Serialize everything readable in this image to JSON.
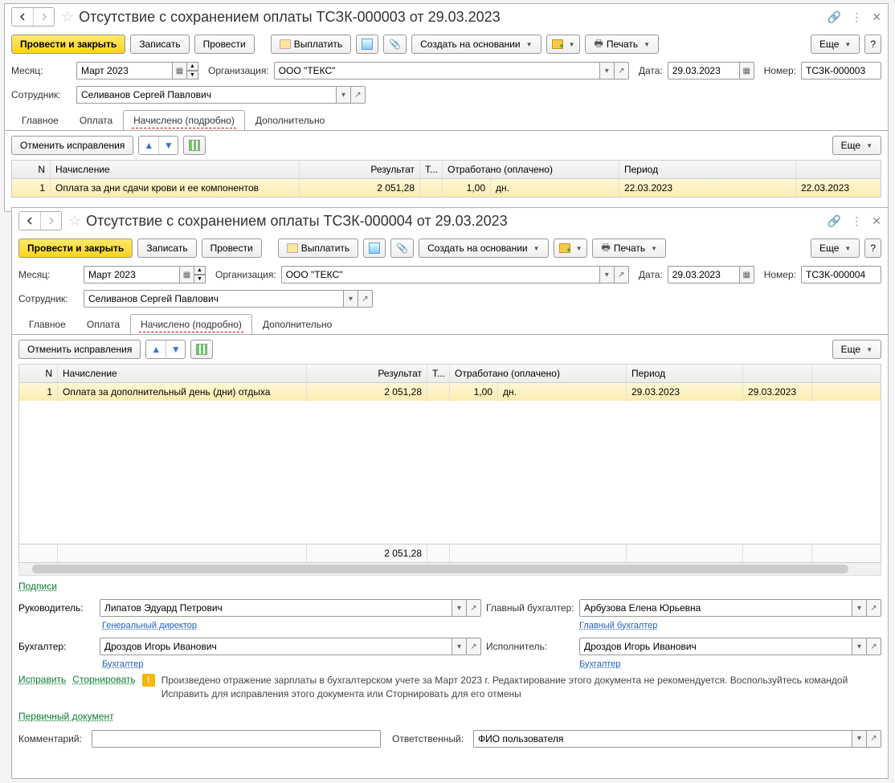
{
  "win1": {
    "title": "Отсутствие с сохранением оплаты ТСЗК-000003 от 29.03.2023",
    "toolbar": {
      "post_close": "Провести и закрыть",
      "write": "Записать",
      "post": "Провести",
      "pay": "Выплатить",
      "create_on": "Создать на основании",
      "print": "Печать",
      "more": "Еще"
    },
    "fields": {
      "month_lbl": "Месяц:",
      "month": "Март 2023",
      "org_lbl": "Организация:",
      "org": "ООО \"ТЕКС\"",
      "date_lbl": "Дата:",
      "date": "29.03.2023",
      "num_lbl": "Номер:",
      "num": "ТСЗК-000003",
      "emp_lbl": "Сотрудник:",
      "emp": "Селиванов Сергей Павлович"
    },
    "tabs": {
      "main": "Главное",
      "pay": "Оплата",
      "calc": "Начислено (подробно)",
      "extra": "Дополнительно"
    },
    "tabbar": {
      "cancel": "Отменить исправления",
      "more": "Еще"
    },
    "table": {
      "headers": {
        "n": "N",
        "nach": "Начисление",
        "res": "Результат",
        "t": "Т...",
        "otr": "Отработано (оплачено)",
        "per": "Период"
      },
      "row": {
        "n": "1",
        "nach": "Оплата за дни сдачи крови и ее компонентов",
        "res": "2 051,28",
        "ot": "1,00",
        "ed": "дн.",
        "p1": "22.03.2023",
        "p2": "22.03.2023"
      }
    }
  },
  "win2": {
    "title": "Отсутствие с сохранением оплаты ТСЗК-000004 от 29.03.2023",
    "toolbar": {
      "post_close": "Провести и закрыть",
      "write": "Записать",
      "post": "Провести",
      "pay": "Выплатить",
      "create_on": "Создать на основании",
      "print": "Печать",
      "more": "Еще"
    },
    "fields": {
      "month_lbl": "Месяц:",
      "month": "Март 2023",
      "org_lbl": "Организация:",
      "org": "ООО \"ТЕКС\"",
      "date_lbl": "Дата:",
      "date": "29.03.2023",
      "num_lbl": "Номер:",
      "num": "ТСЗК-000004",
      "emp_lbl": "Сотрудник:",
      "emp": "Селиванов Сергей Павлович"
    },
    "tabs": {
      "main": "Главное",
      "pay": "Оплата",
      "calc": "Начислено (подробно)",
      "extra": "Дополнительно"
    },
    "tabbar": {
      "cancel": "Отменить исправления",
      "more": "Еще"
    },
    "table": {
      "headers": {
        "n": "N",
        "nach": "Начисление",
        "res": "Результат",
        "t": "Т...",
        "otr": "Отработано (оплачено)",
        "per": "Период"
      },
      "row": {
        "n": "1",
        "nach": "Оплата за дополнительный день (дни) отдыха",
        "res": "2 051,28",
        "ot": "1,00",
        "ed": "дн.",
        "p1": "29.03.2023",
        "p2": "29.03.2023"
      },
      "total": "2 051,28"
    },
    "signatures": {
      "header": "Подписи",
      "ruk_lbl": "Руководитель:",
      "ruk": "Липатов Эдуард Петрович",
      "ruk_pos": "Генеральный директор",
      "glb_lbl": "Главный бухгалтер:",
      "glb": "Арбузова Елена Юрьевна",
      "glb_pos": "Главный бухгалтер",
      "buh_lbl": "Бухгалтер:",
      "buh": "Дроздов Игорь Иванович",
      "buh_pos": "Бухгалтер",
      "isp_lbl": "Исполнитель:",
      "isp": "Дроздов Игорь Иванович",
      "isp_pos": "Бухгалтер"
    },
    "actions": {
      "fix": "Исправить",
      "storno": "Сторнировать"
    },
    "warning": "Произведено отражение зарплаты в бухгалтерском учете за Март 2023 г. Редактирование этого документа не рекомендуется. Воспользуйтесь командой Исправить для исправления этого документа или Сторнировать для его отмены",
    "primary_doc": "Первичный документ",
    "comment_lbl": "Комментарий:",
    "resp_lbl": "Ответственный:",
    "resp": "ФИО пользователя"
  }
}
